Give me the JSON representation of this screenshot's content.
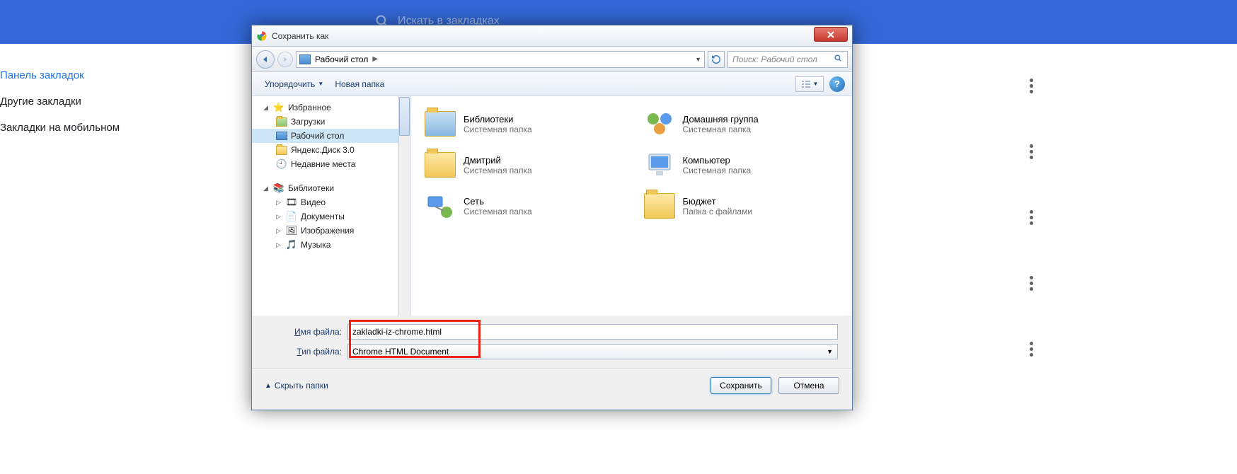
{
  "bg": {
    "search_placeholder": "Искать в закладках",
    "sidebar": [
      {
        "label": "Панель закладок",
        "active": true
      },
      {
        "label": "Другие закладки",
        "active": false
      },
      {
        "label": "Закладки на мобильном",
        "active": false
      }
    ]
  },
  "dialog": {
    "title": "Сохранить как",
    "breadcrumb": "Рабочий стол",
    "search_placeholder": "Поиск: Рабочий стол",
    "toolbar": {
      "organize": "Упорядочить",
      "new_folder": "Новая папка"
    },
    "tree": {
      "favorites": {
        "label": "Избранное",
        "items": [
          {
            "label": "Загрузки",
            "icon": "download"
          },
          {
            "label": "Рабочий стол",
            "icon": "desktop",
            "selected": true
          },
          {
            "label": "Яндекс.Диск 3.0",
            "icon": "folder"
          },
          {
            "label": "Недавние места",
            "icon": "recent"
          }
        ]
      },
      "libraries": {
        "label": "Библиотеки",
        "items": [
          {
            "label": "Видео",
            "icon": "video"
          },
          {
            "label": "Документы",
            "icon": "docs"
          },
          {
            "label": "Изображения",
            "icon": "images"
          },
          {
            "label": "Музыка",
            "icon": "music"
          }
        ]
      }
    },
    "items": [
      {
        "name": "Библиотеки",
        "sub": "Системная папка",
        "icon": "libraries"
      },
      {
        "name": "Домашняя группа",
        "sub": "Системная папка",
        "icon": "homegroup"
      },
      {
        "name": "Дмитрий",
        "sub": "Системная папка",
        "icon": "user"
      },
      {
        "name": "Компьютер",
        "sub": "Системная папка",
        "icon": "computer"
      },
      {
        "name": "Сеть",
        "sub": "Системная папка",
        "icon": "network"
      },
      {
        "name": "Бюджет",
        "sub": "Папка с файлами",
        "icon": "folder"
      }
    ],
    "filename_label": "Имя файла:",
    "filetype_label": "Тип файла:",
    "filename_value": "zakladki-iz-chrome.html",
    "filetype_value": "Chrome HTML Document",
    "hide_folders": "Скрыть папки",
    "save_btn": "Сохранить",
    "cancel_btn": "Отмена"
  }
}
